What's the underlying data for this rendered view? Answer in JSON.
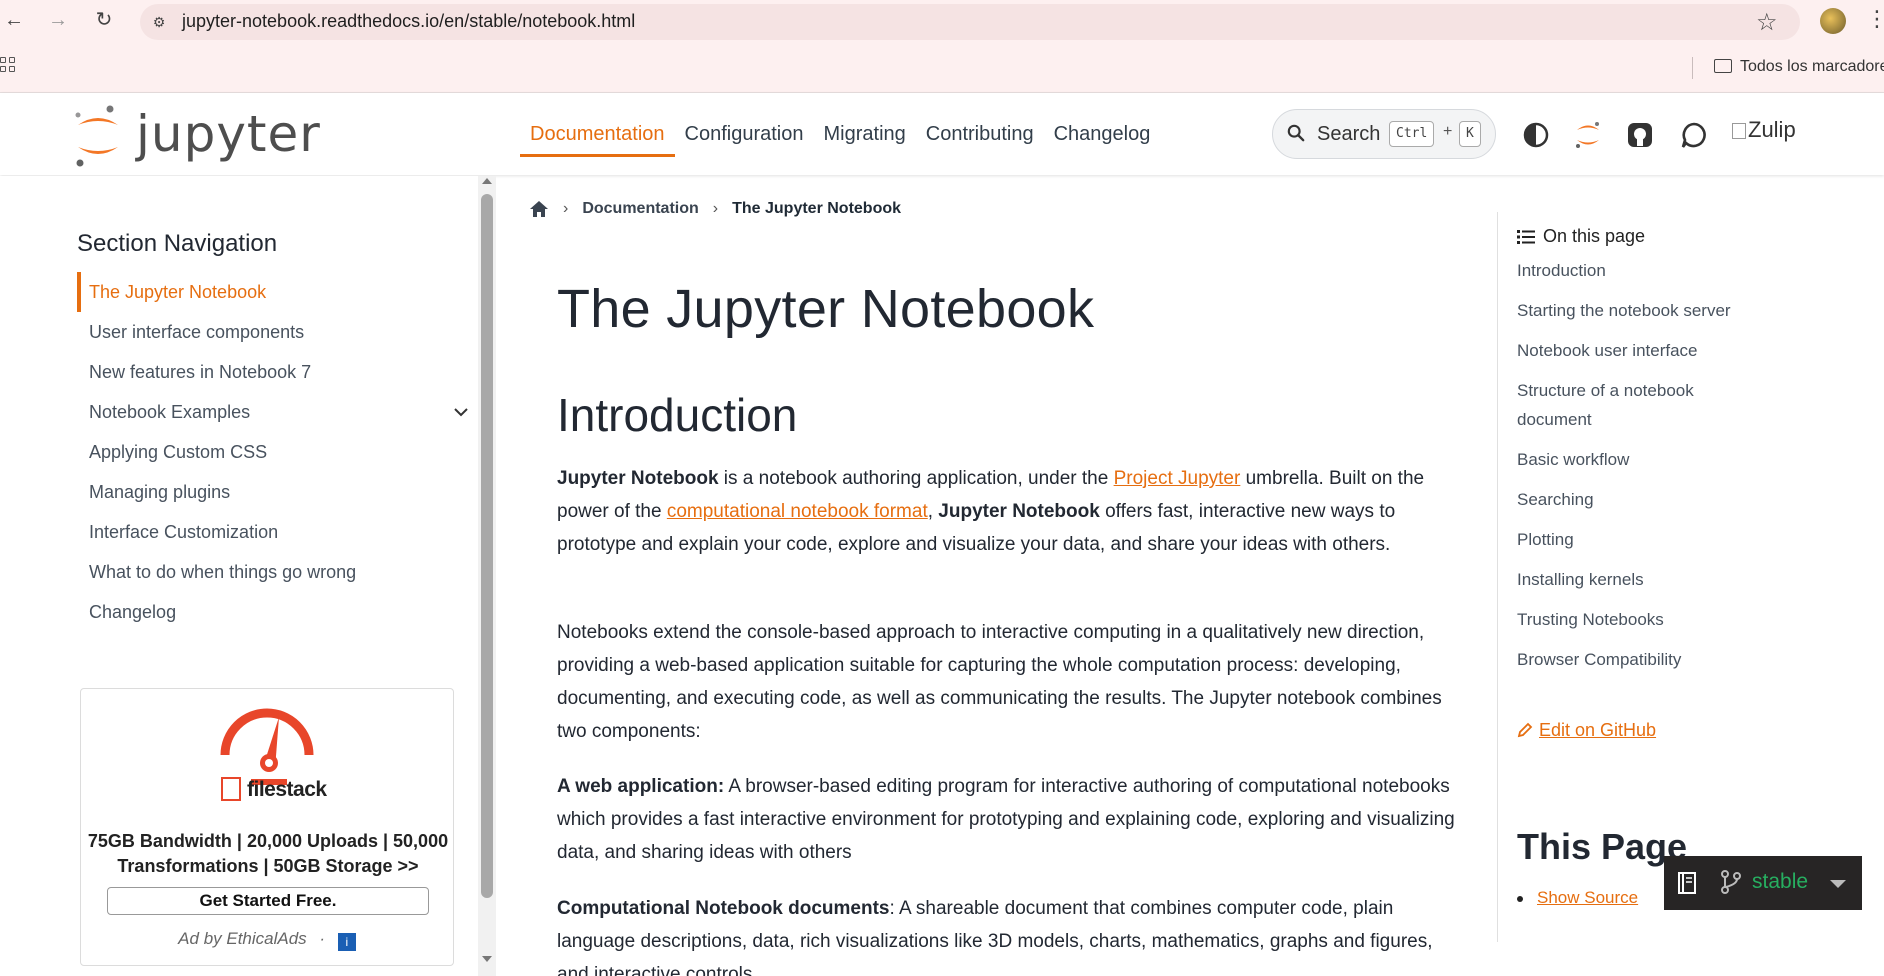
{
  "browser": {
    "url": "jupyter-notebook.readthedocs.io/en/stable/notebook.html",
    "bookmarks_folder": "Todos los marcadores"
  },
  "header": {
    "logo_text": "jupyter",
    "nav": [
      {
        "label": "Documentation",
        "active": true
      },
      {
        "label": "Configuration"
      },
      {
        "label": "Migrating"
      },
      {
        "label": "Contributing"
      },
      {
        "label": "Changelog"
      }
    ],
    "search": {
      "label": "Search",
      "kbd_ctrl": "Ctrl",
      "kbd_plus": "+",
      "kbd_k": "K"
    },
    "zulip_alt": "Zulip"
  },
  "sidebar": {
    "title": "Section Navigation",
    "items": [
      {
        "label": "The Jupyter Notebook",
        "current": true
      },
      {
        "label": "User interface components"
      },
      {
        "label": "New features in Notebook 7"
      },
      {
        "label": "Notebook Examples",
        "expandable": true
      },
      {
        "label": "Applying Custom CSS"
      },
      {
        "label": "Managing plugins"
      },
      {
        "label": "Interface Customization"
      },
      {
        "label": "What to do when things go wrong"
      },
      {
        "label": "Changelog"
      }
    ],
    "ad": {
      "brand": "filestack",
      "text": "75GB Bandwidth | 20,000 Uploads | 50,000 Transformations | 50GB Storage >>",
      "cta": "Get Started Free.",
      "by": "Ad by EthicalAds",
      "dot": "·",
      "info": "i"
    }
  },
  "breadcrumb": {
    "link": "Documentation",
    "current": "The Jupyter Notebook"
  },
  "content": {
    "title": "The Jupyter Notebook",
    "section": "Introduction",
    "p1_b1": "Jupyter Notebook",
    "p1_t1": " is a notebook authoring application, under the ",
    "p1_a1": "Project Jupyter",
    "p1_t2": " umbrella. Built on the power of the ",
    "p1_a2": "computational notebook format",
    "p1_t3": ", ",
    "p1_b2": "Jupyter Notebook",
    "p1_t4": " offers fast, interactive new ways to prototype and explain your code, explore and visualize your data, and share your ideas with others.",
    "p2": "Notebooks extend the console-based approach to interactive computing in a qualitatively new direction, providing a web-based application suitable for capturing the whole computation process: developing, documenting, and executing code, as well as communicating the results. The Jupyter notebook combines two components:",
    "p3_b": "A web application:",
    "p3_t": " A browser-based editing program for interactive authoring of computational notebooks which provides a fast interactive environment for prototyping and explaining code, exploring and visualizing data, and sharing ideas with others",
    "p4_b": "Computational Notebook documents",
    "p4_t": ": A shareable document that combines computer code, plain language descriptions, data, rich visualizations like 3D models, charts, mathematics, graphs and figures, and interactive controls."
  },
  "toc": {
    "heading": "On this page",
    "items": [
      "Introduction",
      "Starting the notebook server",
      "Notebook user interface",
      "Structure of a notebook document",
      "Basic workflow",
      "Searching",
      "Plotting",
      "Installing kernels",
      "Trusting Notebooks",
      "Browser Compatibility"
    ],
    "edit_github": "Edit on GitHub",
    "this_page": "This Page",
    "show_source": "Show Source"
  },
  "rtd": {
    "version": "stable"
  },
  "colors": {
    "accent": "#e66e10",
    "text": "#222832",
    "rtd_green": "#27ae60"
  }
}
